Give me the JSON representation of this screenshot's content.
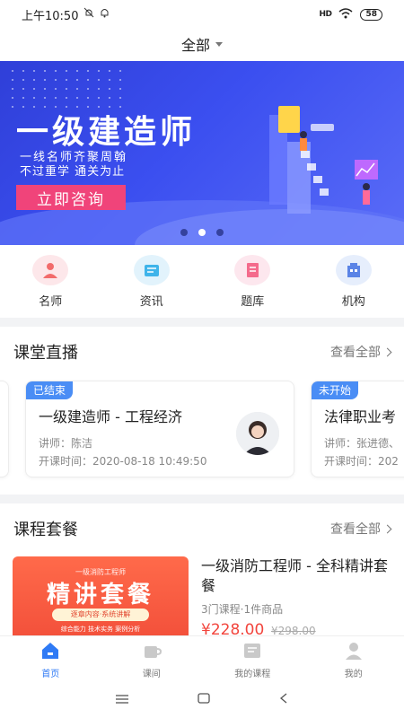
{
  "status_bar": {
    "time": "上午10:50",
    "signal": "HD",
    "battery": "58"
  },
  "header": {
    "title": "全部"
  },
  "banner": {
    "title": "一级建造师",
    "subtitle1": "一线名师齐聚周翰",
    "subtitle2": "不过重学  通关为止",
    "cta": "立即咨询",
    "slide_count": 3,
    "active_slide": 2
  },
  "quick_nav": [
    {
      "label": "名师",
      "icon": "teacher-icon",
      "bg": "#fde7ea",
      "color": "#f26b6b"
    },
    {
      "label": "资讯",
      "icon": "news-icon",
      "bg": "#e2f3fc",
      "color": "#3fb4ea"
    },
    {
      "label": "题库",
      "icon": "question-bank-icon",
      "bg": "#fde7ee",
      "color": "#f46b8c"
    },
    {
      "label": "机构",
      "icon": "institution-icon",
      "bg": "#e6eefc",
      "color": "#5b84e6"
    }
  ],
  "live_section": {
    "title": "课堂直播",
    "more": "查看全部",
    "cards": [
      {
        "badge": "已结束",
        "title": "一级建造师 - 工程经济",
        "teacher": "讲师：陈洁",
        "time": "开课时间：2020-08-18 10:49:50"
      },
      {
        "badge": "未开始",
        "title": "法律职业考",
        "teacher": "讲师：张进德、",
        "time": "开课时间：202"
      }
    ]
  },
  "package_section": {
    "title": "课程套餐",
    "more": "查看全部",
    "item": {
      "image_small": "一级消防工程师",
      "image_big": "精讲套餐",
      "image_pill": "逐章内容·系统讲解",
      "image_tiny": "综合能力  技术实务  案例分析",
      "title": "一级消防工程师 - 全科精讲套餐",
      "meta": "3门课程·1件商品",
      "price": "¥228.00",
      "orig_price": "¥298.00"
    }
  },
  "tabbar": [
    {
      "label": "首页",
      "icon": "home-icon",
      "active": true
    },
    {
      "label": "课间",
      "icon": "coffee-cup-icon",
      "active": false
    },
    {
      "label": "我的课程",
      "icon": "course-book-icon",
      "active": false
    },
    {
      "label": "我的",
      "icon": "user-icon",
      "active": false
    }
  ],
  "colors": {
    "accent": "#2f7af5",
    "banner": "#3b4ff0",
    "cta": "#f0447a",
    "price": "#f2453d",
    "badge": "#4a8df5"
  }
}
